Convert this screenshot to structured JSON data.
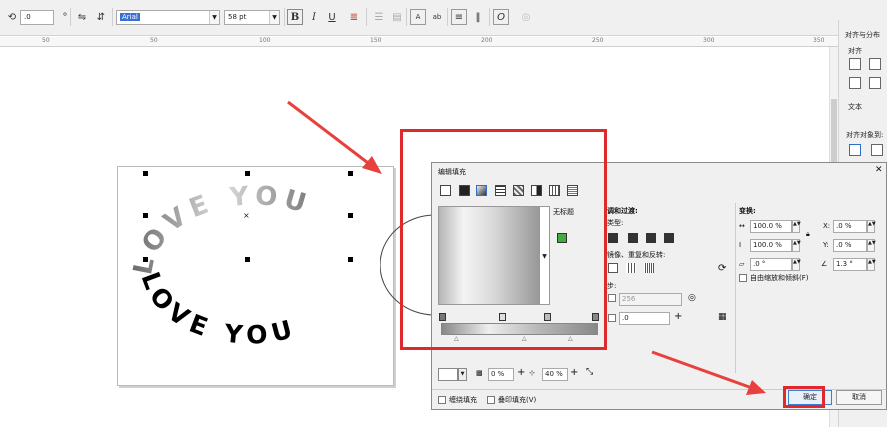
{
  "toolbar": {
    "rotate_value": ".0",
    "font_name": "Arial",
    "font_size": "58 pt",
    "bold_label": "B",
    "italic_label": "I",
    "underline_label": "U",
    "ab_label": "ab",
    "a_label": "A"
  },
  "ruler": {
    "ticks": [
      "50",
      "50",
      "100",
      "150",
      "200",
      "250",
      "300",
      "350"
    ]
  },
  "right_panel": {
    "title": "对齐与分布",
    "section_align": "对齐",
    "section_text": "文本",
    "align_to": "对齐对象到:"
  },
  "canvas": {
    "outer_text": "LOVE YOU",
    "inner_text": "LOVE YOU"
  },
  "dialog": {
    "title": "编辑填充",
    "close_label": "✕",
    "preset_name": "无标题",
    "blend_title": "调和过渡:",
    "type_label": "类型:",
    "mirror_label": "镜像、重复和反转:",
    "accel_label": "步:",
    "steps_value": "256",
    "node_position": ".0",
    "transform_title": "变换:",
    "width_value": "100.0 %",
    "height_value": "100.0 %",
    "x_value": ".0 %",
    "y_value": ".0 %",
    "skew_value": ".0 °",
    "rotate_value": "1.3 °",
    "free_scale_label": "自由缩放和倾斜(F)",
    "transparency_value": "0 %",
    "midpoint_value": "40 %",
    "wrap_fill_label": "缠绕填充",
    "overprint_label": "叠印填充(V)",
    "ok_label": "确定",
    "cancel_label": "取消"
  },
  "colors": {
    "highlight": "#e0292b",
    "arrow": "#e8403c"
  }
}
